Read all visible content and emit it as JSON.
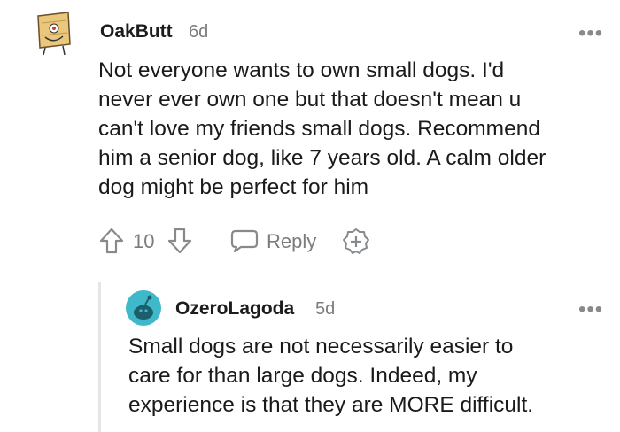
{
  "comments": [
    {
      "username": "OakButt",
      "age": "6d",
      "avatar": "oakbutt-avatar",
      "text": "Not everyone wants to own small dogs. I'd never ever own one but that doesn't mean u can't love my friends small dogs. Recommend him a senior dog, like 7 years old. A calm older dog might be perfect for him",
      "lines": [
        "Not everyone wants to own small dogs. I'd",
        "never ever own one but that doesn't mean u",
        "can't love my friends small dogs. Recommend",
        "him a senior dog, like 7 years old. A calm older",
        "dog might be perfect for him"
      ],
      "score": "10",
      "reply_label": "Reply"
    },
    {
      "username": "OzeroLagoda",
      "age": "5d",
      "avatar": "default-snoo-avatar",
      "lines": [
        "Small dogs are not necessarily easier to",
        "care for than large dogs. Indeed, my",
        "experience is that they are MORE difficult."
      ]
    }
  ],
  "more_label": "•••",
  "colors": {
    "text": "#1a1a1b",
    "meta": "#7c7c7c",
    "icon": "#878a8c",
    "thread_line": "#e4e6e8",
    "avatar_teal": "#3fb8c9"
  },
  "icons": [
    "upvote-icon",
    "downvote-icon",
    "reply-icon",
    "award-icon",
    "more-icon"
  ]
}
